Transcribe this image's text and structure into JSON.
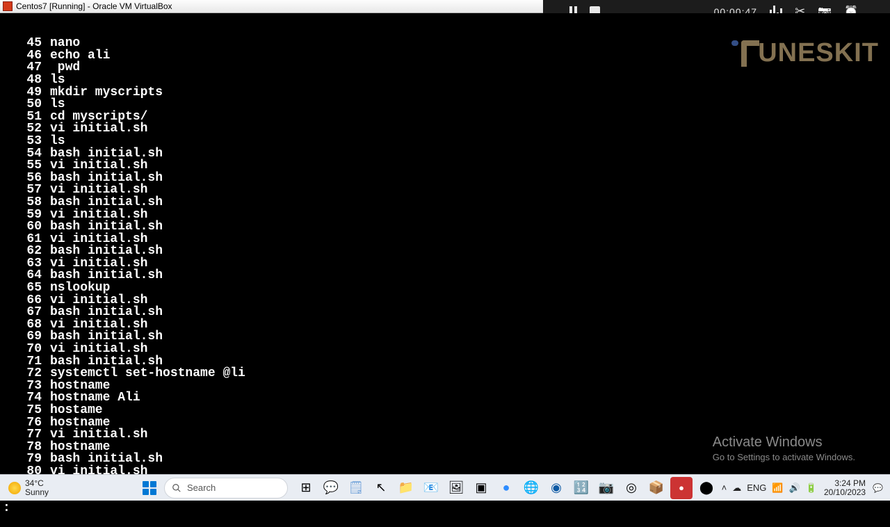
{
  "vbox": {
    "title": "Centos7 [Running] - Oracle VM VirtualBox"
  },
  "recorder": {
    "timer": "00:00:47"
  },
  "watermark": {
    "text": "UNESKIT"
  },
  "activate": {
    "line1": "Activate Windows",
    "line2": "Go to Settings to activate Windows."
  },
  "terminal": {
    "prompt": ":",
    "history": [
      {
        "n": "45",
        "cmd": "nano"
      },
      {
        "n": "46",
        "cmd": "echo ali"
      },
      {
        "n": "47",
        "cmd": " pwd"
      },
      {
        "n": "48",
        "cmd": "ls"
      },
      {
        "n": "49",
        "cmd": "mkdir myscripts"
      },
      {
        "n": "50",
        "cmd": "ls"
      },
      {
        "n": "51",
        "cmd": "cd myscripts/"
      },
      {
        "n": "52",
        "cmd": "vi initial.sh"
      },
      {
        "n": "53",
        "cmd": "ls"
      },
      {
        "n": "54",
        "cmd": "bash initial.sh"
      },
      {
        "n": "55",
        "cmd": "vi initial.sh"
      },
      {
        "n": "56",
        "cmd": "bash initial.sh"
      },
      {
        "n": "57",
        "cmd": "vi initial.sh"
      },
      {
        "n": "58",
        "cmd": "bash initial.sh"
      },
      {
        "n": "59",
        "cmd": "vi initial.sh"
      },
      {
        "n": "60",
        "cmd": "bash initial.sh"
      },
      {
        "n": "61",
        "cmd": "vi initial.sh"
      },
      {
        "n": "62",
        "cmd": "bash initial.sh"
      },
      {
        "n": "63",
        "cmd": "vi initial.sh"
      },
      {
        "n": "64",
        "cmd": "bash initial.sh"
      },
      {
        "n": "65",
        "cmd": "nslookup"
      },
      {
        "n": "66",
        "cmd": "vi initial.sh"
      },
      {
        "n": "67",
        "cmd": "bash initial.sh"
      },
      {
        "n": "68",
        "cmd": "vi initial.sh"
      },
      {
        "n": "69",
        "cmd": "bash initial.sh"
      },
      {
        "n": "70",
        "cmd": "vi initial.sh"
      },
      {
        "n": "71",
        "cmd": "bash initial.sh"
      },
      {
        "n": "72",
        "cmd": "systemctl set-hostname @li"
      },
      {
        "n": "73",
        "cmd": "hostname"
      },
      {
        "n": "74",
        "cmd": "hostname Ali"
      },
      {
        "n": "75",
        "cmd": "hostame"
      },
      {
        "n": "76",
        "cmd": "hostname"
      },
      {
        "n": "77",
        "cmd": "vi initial.sh"
      },
      {
        "n": "78",
        "cmd": "hostname"
      },
      {
        "n": "79",
        "cmd": "bash initial.sh"
      },
      {
        "n": "80",
        "cmd": "vi initial.sh"
      }
    ]
  },
  "taskbar": {
    "weather_temp": "34°C",
    "weather_desc": "Sunny",
    "search_placeholder": "Search",
    "time": "3:24 PM",
    "date": "20/10/2023"
  }
}
